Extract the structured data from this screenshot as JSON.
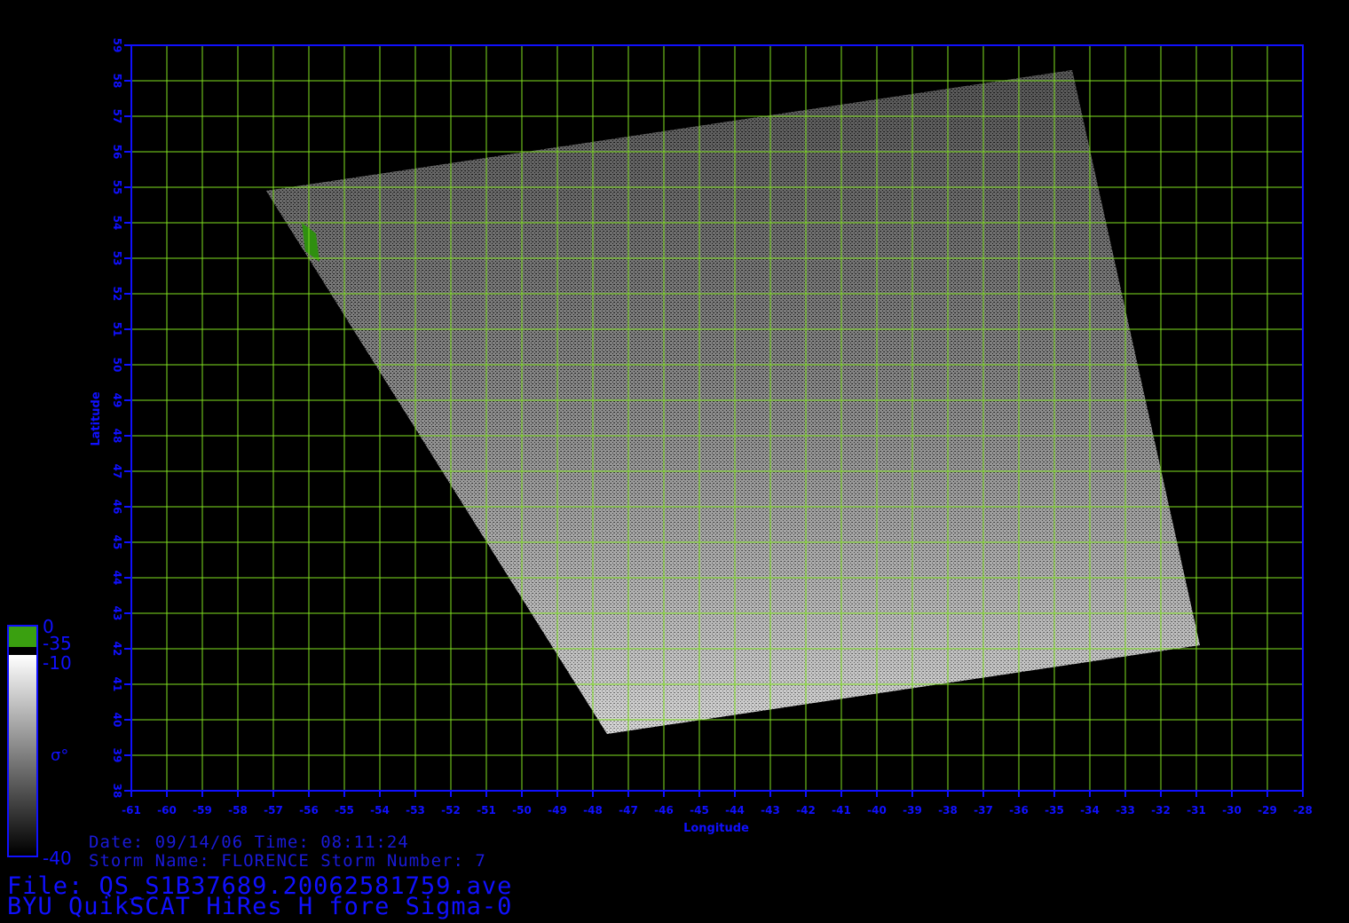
{
  "plot": {
    "x_axis_label": "Longitude",
    "y_axis_label": "Latitude",
    "x_ticks": [
      "-61",
      "-60",
      "-59",
      "-58",
      "-57",
      "-56",
      "-55",
      "-54",
      "-53",
      "-52",
      "-51",
      "-50",
      "-49",
      "-48",
      "-47",
      "-46",
      "-45",
      "-44",
      "-43",
      "-42",
      "-41",
      "-40",
      "-39",
      "-38",
      "-37",
      "-36",
      "-35",
      "-34",
      "-33",
      "-32",
      "-31",
      "-30",
      "-29",
      "-28"
    ],
    "y_ticks": [
      "38",
      "39",
      "40",
      "41",
      "42",
      "43",
      "44",
      "45",
      "46",
      "47",
      "48",
      "49",
      "50",
      "51",
      "52",
      "53",
      "54",
      "55",
      "56",
      "57",
      "58",
      "59"
    ],
    "lon_range": [
      -61,
      -28
    ],
    "lat_range": [
      38,
      59
    ],
    "swath_corners_lonlat": [
      [
        -57.2,
        54.9
      ],
      [
        -34.5,
        58.3
      ],
      [
        -30.9,
        42.1
      ],
      [
        -47.6,
        39.6
      ]
    ],
    "grid_color": "#7fe020",
    "axis_color": "#1010ff",
    "background_color": "#000000"
  },
  "colorbar": {
    "land_top_label": "0",
    "land_bottom_label": "-35",
    "ocean_top_label": "-10",
    "ocean_bottom_label": "-40",
    "symbol": "σ°",
    "land_color": "#3aa010",
    "ocean_gradient": [
      "#ffffff",
      "#000000"
    ]
  },
  "info": {
    "date_time": "Date: 09/14/06   Time: 08:11:24",
    "storm": "Storm Name: FLORENCE   Storm Number: 7",
    "file": "File: QS_S1B37689.20062581759.ave",
    "product": "BYU QuikSCAT HiRes H fore Sigma-0"
  }
}
